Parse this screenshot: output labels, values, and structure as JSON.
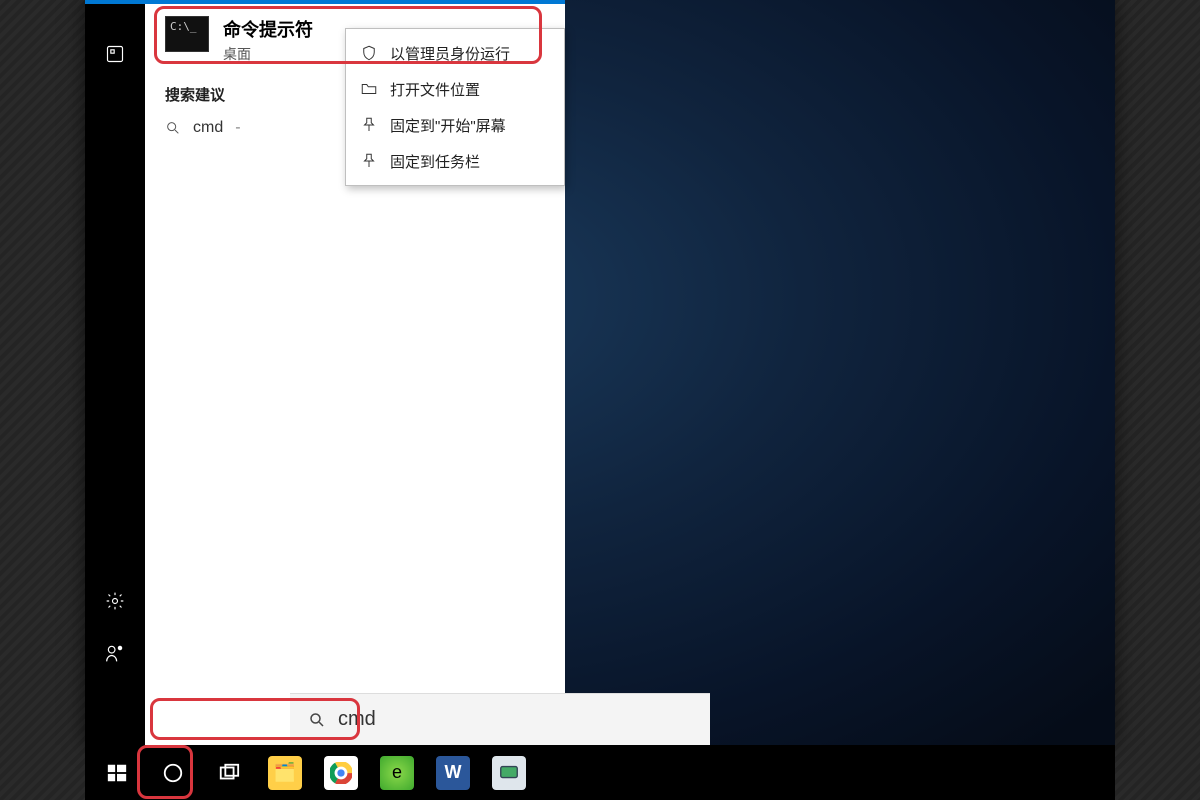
{
  "best_match": {
    "title": "命令提示符",
    "subtitle": "桌面",
    "thumb_text": "C:\\_"
  },
  "section_suggestions_label": "搜索建议",
  "suggestion": {
    "label": "cmd",
    "hint_dash": "-"
  },
  "context_menu": {
    "run_admin": "以管理员身份运行",
    "open_location": "打开文件位置",
    "pin_start": "固定到\"开始\"屏幕",
    "pin_taskbar": "固定到任务栏"
  },
  "search_input": {
    "value": "cmd"
  },
  "taskbar": {
    "start": "Start",
    "cortana": "Cortana / Search",
    "taskview": "Task View",
    "apps": [
      "file-explorer",
      "chrome",
      "edge-legacy",
      "word",
      "vmware"
    ]
  }
}
